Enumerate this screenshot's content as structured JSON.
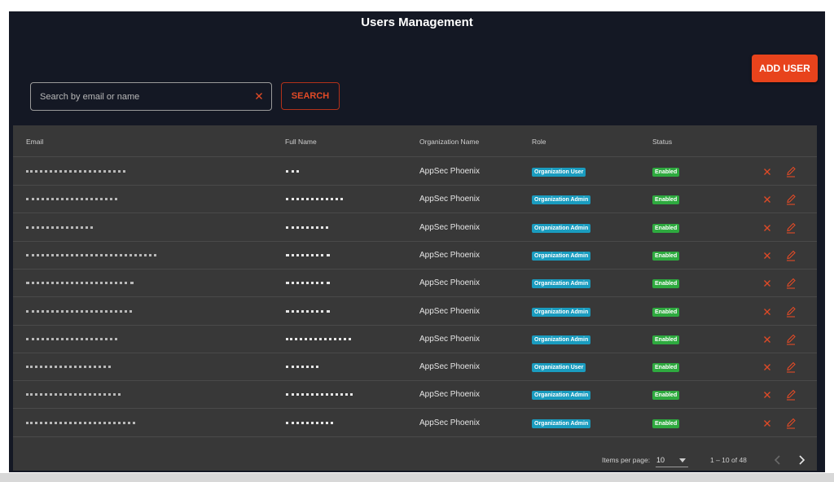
{
  "header": {
    "title": "Users Management",
    "add_user_label": "ADD USER"
  },
  "search": {
    "placeholder": "Search by email or name",
    "value": "",
    "button_label": "SEARCH"
  },
  "table": {
    "columns": [
      "Email",
      "Full Name",
      "Organization Name",
      "Role",
      "Status"
    ],
    "rows": [
      {
        "organization": "AppSec Phoenix",
        "role": "Organization User",
        "status": "Enabled"
      },
      {
        "organization": "AppSec Phoenix",
        "role": "Organization Admin",
        "status": "Enabled"
      },
      {
        "organization": "AppSec Phoenix",
        "role": "Organization Admin",
        "status": "Enabled"
      },
      {
        "organization": "AppSec Phoenix",
        "role": "Organization Admin",
        "status": "Enabled"
      },
      {
        "organization": "AppSec Phoenix",
        "role": "Organization Admin",
        "status": "Enabled"
      },
      {
        "organization": "AppSec Phoenix",
        "role": "Organization Admin",
        "status": "Enabled"
      },
      {
        "organization": "AppSec Phoenix",
        "role": "Organization Admin",
        "status": "Enabled"
      },
      {
        "organization": "AppSec Phoenix",
        "role": "Organization User",
        "status": "Enabled"
      },
      {
        "organization": "AppSec Phoenix",
        "role": "Organization Admin",
        "status": "Enabled"
      },
      {
        "organization": "AppSec Phoenix",
        "role": "Organization Admin",
        "status": "Enabled"
      }
    ]
  },
  "pagination": {
    "items_per_page_label": "Items per page:",
    "items_per_page": "10",
    "range_label": "1 – 10 of 48"
  },
  "icons": {
    "delete": "close-icon",
    "edit": "pencil-icon",
    "clear": "close-icon",
    "prev": "chevron-left-icon",
    "next": "chevron-right-icon",
    "dropdown": "caret-down-icon"
  },
  "colors": {
    "background": "#141824",
    "table": "#383838",
    "accent": "#e8431c",
    "role_badge": "#1a9cbf",
    "status_badge": "#2eaa3f"
  }
}
